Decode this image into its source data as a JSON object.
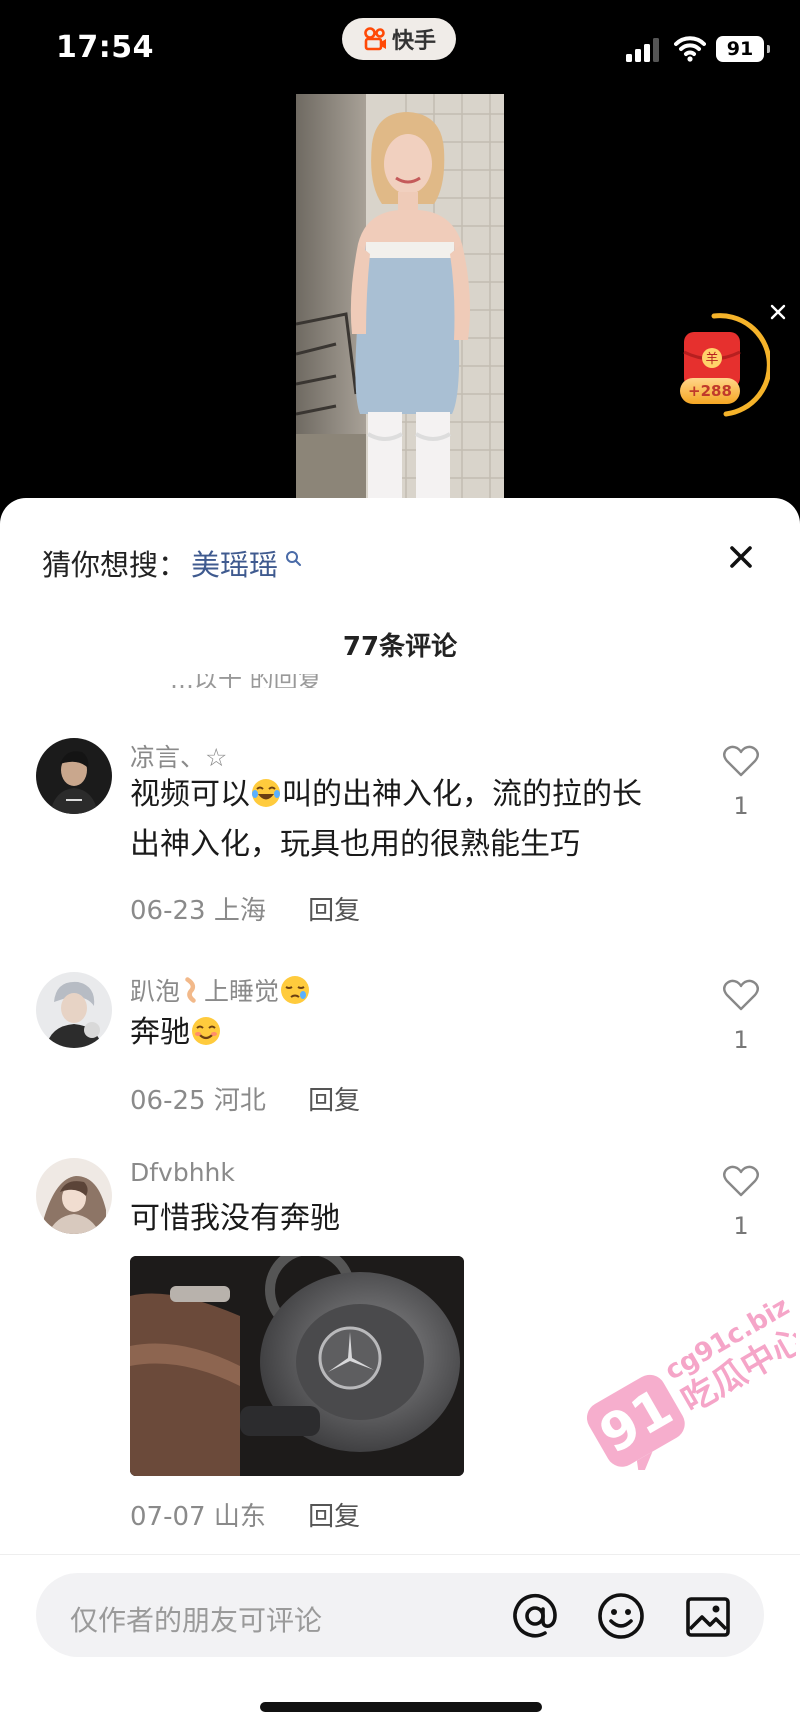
{
  "status_bar": {
    "time": "17:54",
    "battery": "91",
    "app_name": "快手"
  },
  "redpacket": {
    "badge": "+288",
    "packet_char": "羊"
  },
  "sheet": {
    "suggest_label": "猜你想搜：",
    "suggest_keyword": "美瑶瑶",
    "comment_count": "77条评论",
    "cut_text": "…以十  的回复"
  },
  "comments": [
    {
      "name": "凉言、☆",
      "text_a": "视频可以",
      "text_b": "叫的出神入化，流的拉的长  出神入化，玩具也用的很熟能生巧",
      "date": "06-23",
      "location": "上海",
      "reply": "回复",
      "likes": "1"
    },
    {
      "name_a": "趴泡",
      "name_b": "上睡觉",
      "text": "奔驰",
      "date": "06-25",
      "location": "河北",
      "reply": "回复",
      "likes": "1"
    },
    {
      "name": "Dfvbhhk",
      "text": "可惜我没有奔驰",
      "date": "07-07",
      "location": "山东",
      "reply": "回复",
      "likes": "1"
    }
  ],
  "watermark": {
    "number": "91",
    "site": "cg91c.biz",
    "slogan": "吃瓜中心"
  },
  "input": {
    "placeholder": "仅作者的朋友可评论"
  }
}
